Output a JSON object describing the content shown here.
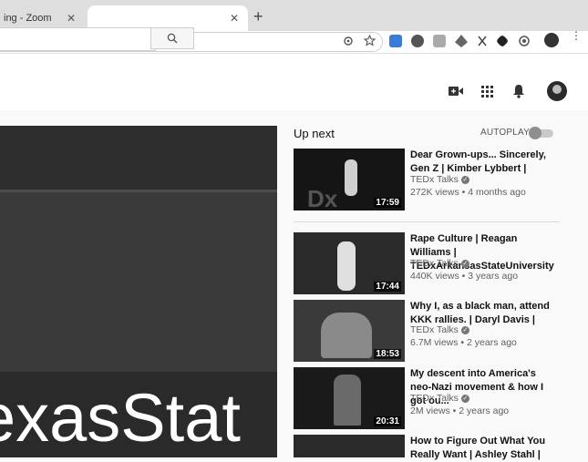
{
  "browser": {
    "tabs": [
      {
        "label": "ing - Zoom",
        "close": "✕"
      },
      {
        "label": "",
        "close": "✕"
      }
    ],
    "new_tab": "+"
  },
  "search": {
    "placeholder": ""
  },
  "player": {
    "overlay_text": "exasStat"
  },
  "upnext": {
    "title": "Up next",
    "autoplay_label": "AUTOPLAY",
    "autoplay_on": false,
    "videos": [
      {
        "title": "Dear Grown-ups... Sincerely, Gen Z | Kimber Lybbert |",
        "channel": "TEDx Talks",
        "meta": "272K views • 4 months ago",
        "duration": "17:59"
      },
      {
        "title": "Rape Culture | Reagan Williams | TEDxArkansasStateUniversity",
        "channel": "TEDx Talks",
        "meta": "440K views • 3 years ago",
        "duration": "17:44"
      },
      {
        "title": "Why I, as a black man, attend KKK rallies. | Daryl Davis |",
        "channel": "TEDx Talks",
        "meta": "6.7M views • 2 years ago",
        "duration": "18:53"
      },
      {
        "title": "My descent into America's neo-Nazi movement & how I got ou...",
        "channel": "TEDx Talks",
        "meta": "2M views • 2 years ago",
        "duration": "20:31"
      },
      {
        "title": "How to Figure Out What You Really Want | Ashley Stahl |",
        "channel": "",
        "meta": "",
        "duration": ""
      }
    ]
  }
}
